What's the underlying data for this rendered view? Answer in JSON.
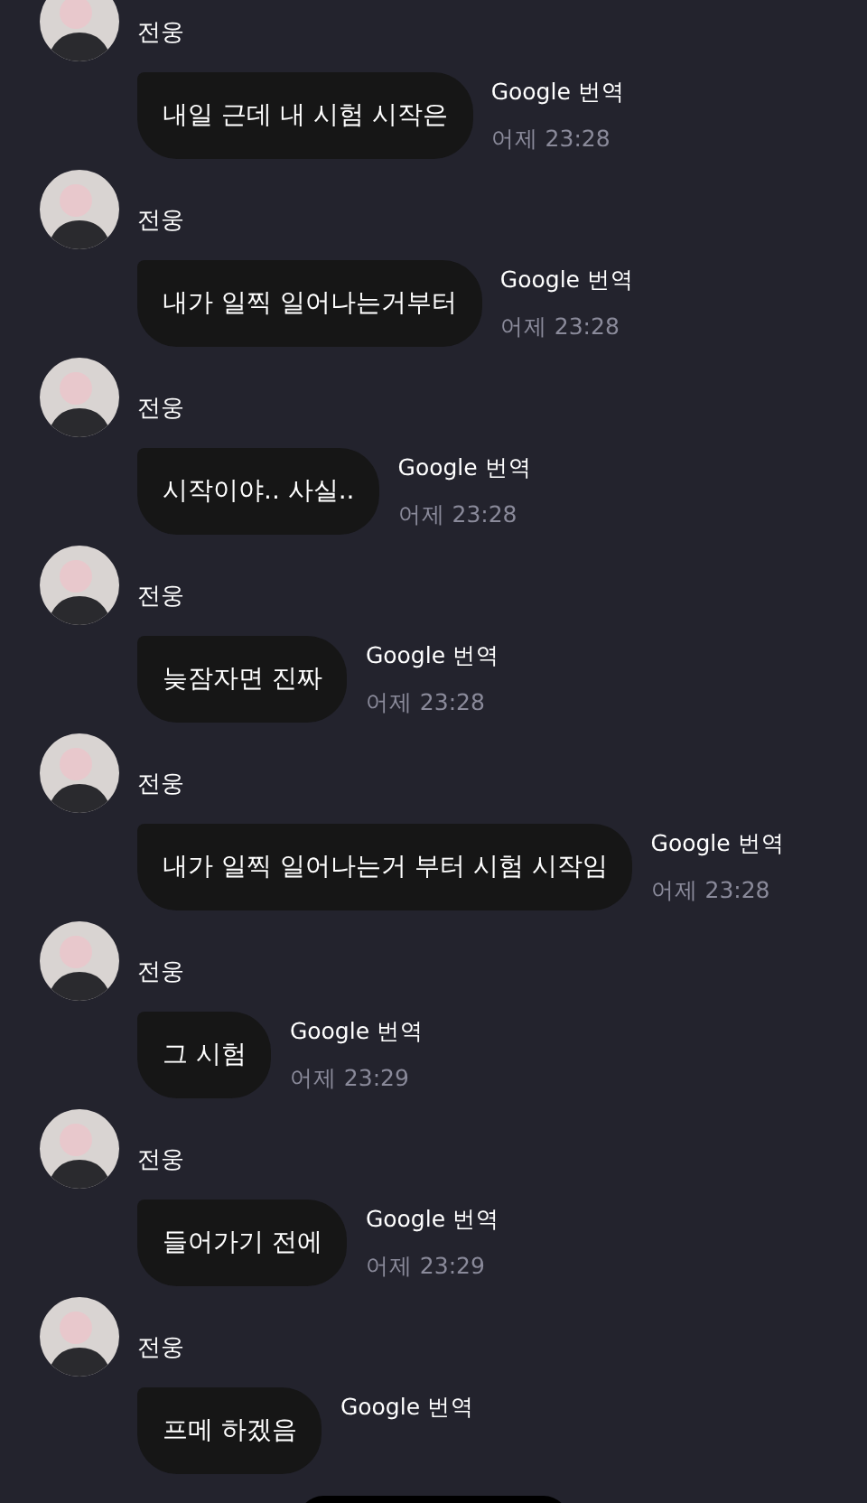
{
  "messages": [
    {
      "sender": "전웅",
      "text": "내일 근데 내 시험 시작은",
      "translate_label": "Google 번역",
      "time": "어제 23:28"
    },
    {
      "sender": "전웅",
      "text": "내가 일찍 일어나는거부터",
      "translate_label": "Google 번역",
      "time": "어제 23:28"
    },
    {
      "sender": "전웅",
      "text": "시작이야.. 사실..",
      "translate_label": "Google 번역",
      "time": "어제 23:28"
    },
    {
      "sender": "전웅",
      "text": "늦잠자면 진짜",
      "translate_label": "Google 번역",
      "time": "어제 23:28"
    },
    {
      "sender": "전웅",
      "text": "내가 일찍 일어나는거 부터 시험 시작임",
      "translate_label": "Google 번역",
      "time": "어제 23:28"
    },
    {
      "sender": "전웅",
      "text": "그 시험",
      "translate_label": "Google 번역",
      "time": "어제 23:29"
    },
    {
      "sender": "전웅",
      "text": "들어가기 전에",
      "translate_label": "Google 번역",
      "time": "어제 23:29"
    },
    {
      "sender": "전웅",
      "text": "프메 하겠음",
      "translate_label": "Google 번역"
    }
  ]
}
